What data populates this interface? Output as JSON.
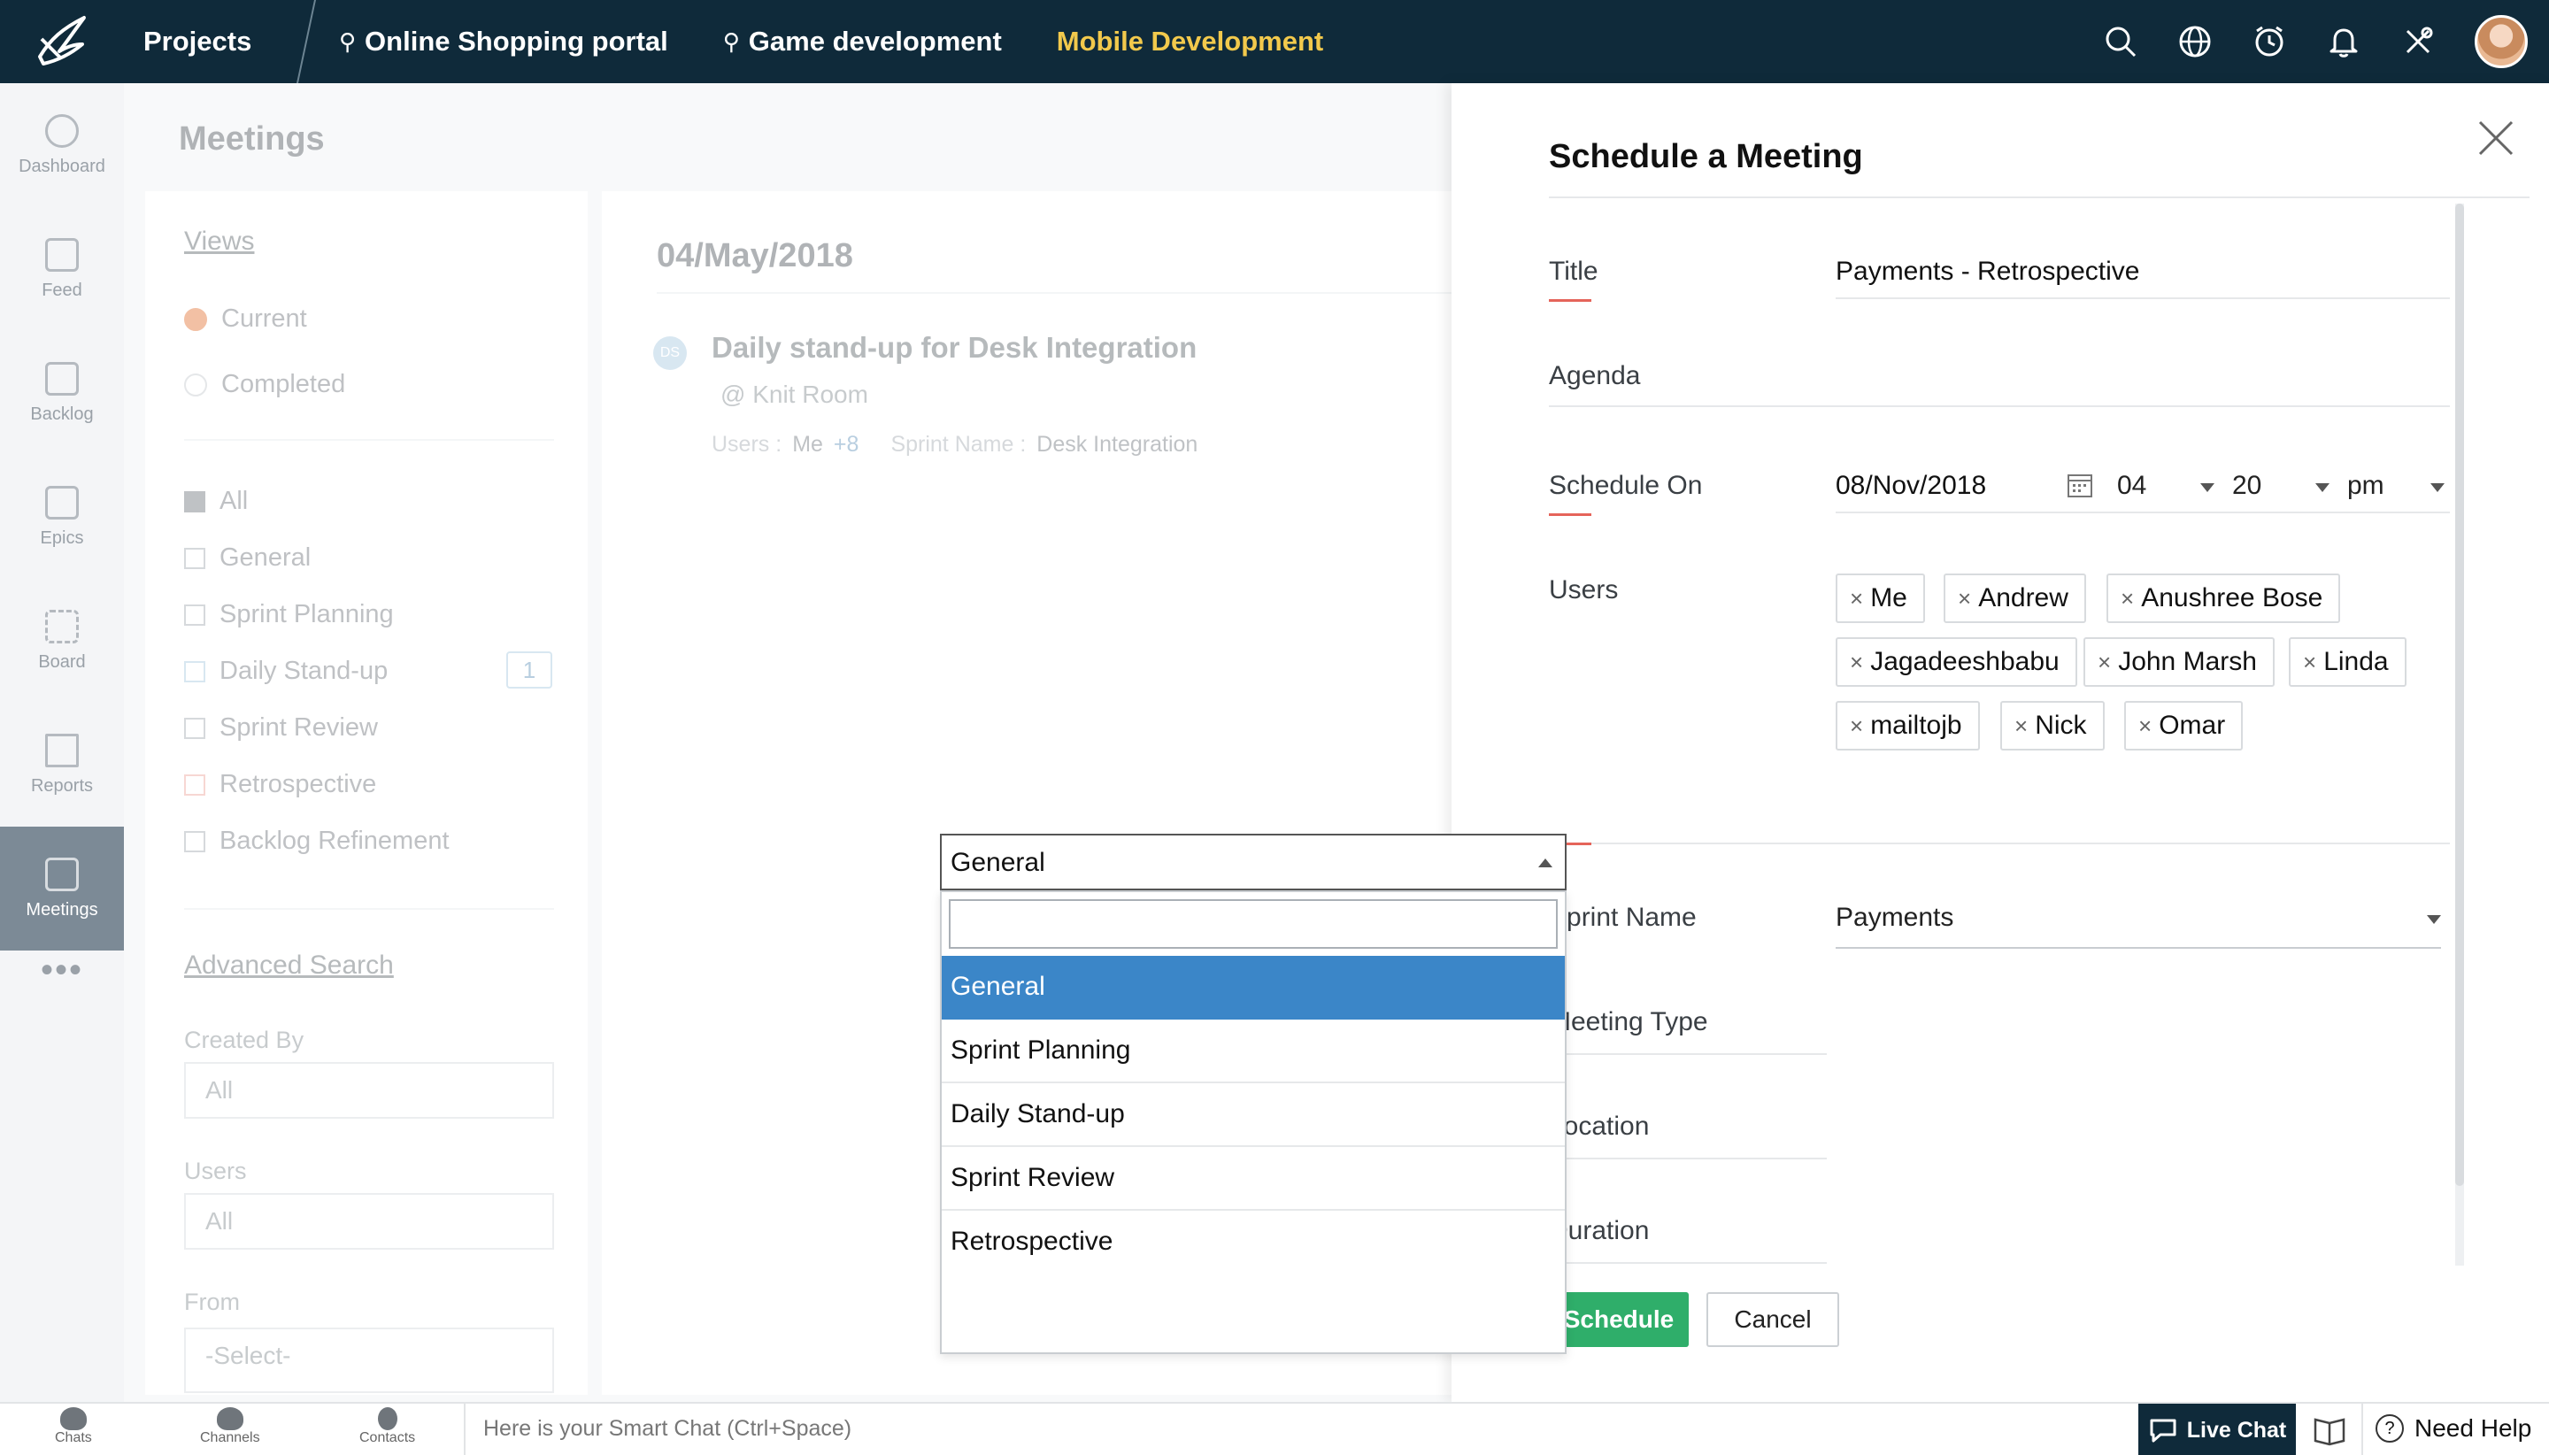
{
  "topbar": {
    "projects": "Projects",
    "tabs": [
      {
        "label": "Online Shopping portal",
        "pin": true
      },
      {
        "label": "Game development",
        "pin": true
      },
      {
        "label": "Mobile Development",
        "pin": false
      }
    ],
    "icons": [
      "search-icon",
      "globe-icon",
      "clock-icon",
      "bell-icon",
      "tools-icon"
    ]
  },
  "sidebar": {
    "items": [
      {
        "label": "Dashboard"
      },
      {
        "label": "Feed"
      },
      {
        "label": "Backlog"
      },
      {
        "label": "Epics"
      },
      {
        "label": "Board"
      },
      {
        "label": "Reports"
      },
      {
        "label": "Meetings"
      }
    ],
    "more": "•••"
  },
  "background": {
    "page_title": "Meetings",
    "views_link": "Views",
    "radios": [
      "Current",
      "Completed"
    ],
    "checks": [
      "All",
      "General",
      "Sprint Planning",
      "Daily Stand-up",
      "Sprint Review",
      "Retrospective",
      "Backlog Refinement"
    ],
    "daily_count": "1",
    "advanced_search": "Advanced Search",
    "created_by_label": "Created By",
    "created_by_value": "All",
    "users_label": "Users",
    "users_value": "All",
    "from_label": "From",
    "from_value": "-Select-",
    "date_heading": "04/May/2018",
    "meeting_badge": "DS",
    "meeting_title": "Daily stand-up for Desk Integration",
    "meeting_location": "@ Knit Room",
    "meta_users_label": "Users :",
    "meta_users_value": "Me",
    "meta_users_more": "+8",
    "meta_sprint_label": "Sprint Name :",
    "meta_sprint_value": "Desk Integration"
  },
  "modal": {
    "title": "Schedule a Meeting",
    "fields": {
      "title_label": "Title",
      "title_value": "Payments - Retrospective",
      "agenda_label": "Agenda",
      "schedule_label": "Schedule On",
      "schedule_date": "08/Nov/2018",
      "hour": "04",
      "minute": "20",
      "ampm": "pm",
      "users_label": "Users",
      "users": [
        "Me",
        "Andrew",
        "Anushree Bose",
        "Jagadeeshbabu",
        "John Marsh",
        "Linda",
        "mailtojb",
        "Nick",
        "Omar"
      ],
      "sprint_label": "Sprint Name",
      "sprint_value": "Payments",
      "type_label": "Meeting Type",
      "type_value": "General",
      "location_label": "Location",
      "duration_label": "Duration"
    },
    "dropdown_options": [
      "General",
      "Sprint Planning",
      "Daily Stand-up",
      "Sprint Review",
      "Retrospective"
    ],
    "schedule_button": "Schedule",
    "cancel_button": "Cancel"
  },
  "bottombar": {
    "items": [
      "Chats",
      "Channels",
      "Contacts"
    ],
    "chat_hint": "Here is your Smart Chat (Ctrl+Space)",
    "live_chat": "Live Chat",
    "need_help": "Need Help"
  },
  "colors": {
    "topbar_bg": "#0f2a3a",
    "active_tab": "#f2c94c",
    "schedule_green": "#2fae6a",
    "selected_blue": "#3b86c8",
    "required_red": "#e5645a"
  }
}
